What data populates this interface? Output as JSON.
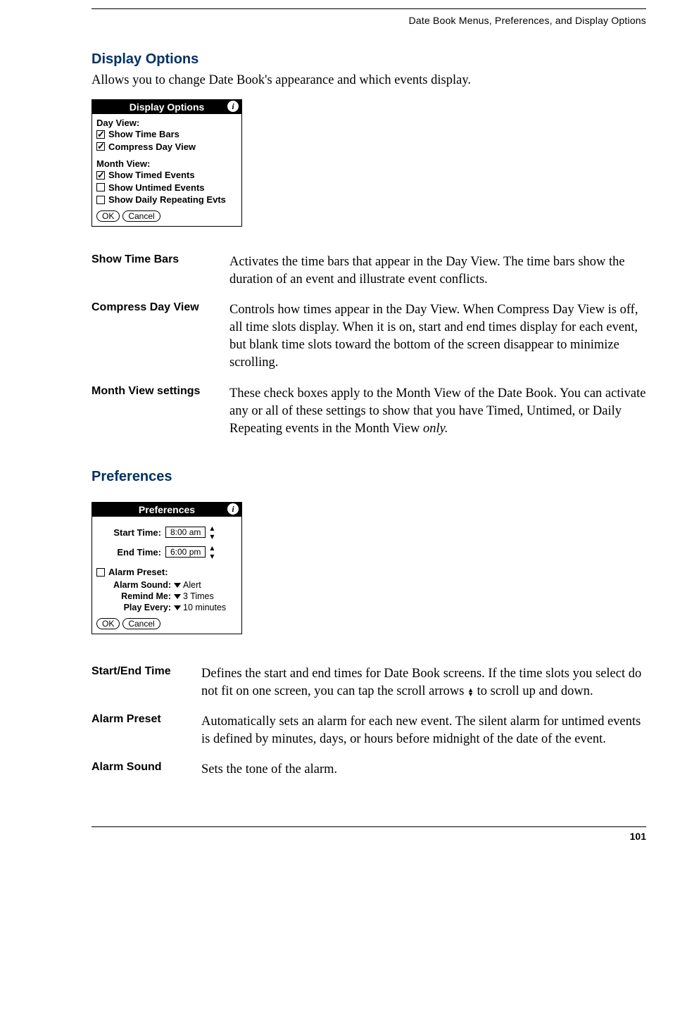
{
  "header": {
    "running_head": "Date Book Menus, Preferences, and Display Options"
  },
  "section1": {
    "title": "Display Options",
    "intro": "Allows you to change Date Book's appearance and which events display."
  },
  "figure1": {
    "title": "Display Options",
    "section_a": "Day View:",
    "row_a1": "Show Time Bars",
    "row_a2": "Compress Day View",
    "section_b": "Month View:",
    "row_b1": "Show Timed Events",
    "row_b2": "Show Untimed Events",
    "row_b3": "Show Daily Repeating Evts",
    "btn_ok": "OK",
    "btn_cancel": "Cancel"
  },
  "defs1": [
    {
      "term": "Show Time Bars",
      "desc": "Activates the time bars that appear in the Day View. The time bars show the duration of an event and illustrate event conflicts."
    },
    {
      "term": "Compress Day View",
      "desc": "Controls how times appear in the Day View. When Compress Day View is off, all time slots display. When it is on, start and end times display for each event, but blank time slots toward the bottom of the screen disappear to minimize scrolling."
    },
    {
      "term": "Month View settings",
      "desc_prefix": "These check boxes apply to the Month View of the Date Book. You can activate any or all of these settings to show that you have Timed, Untimed, or Daily Repeating events in the Month View ",
      "desc_italic": "only."
    }
  ],
  "section2": {
    "title": "Preferences"
  },
  "figure2": {
    "title": "Preferences",
    "start_label": "Start Time:",
    "start_value": "8:00 am",
    "end_label": "End Time:",
    "end_value": "6:00 pm",
    "alarm_preset_label": "Alarm Preset:",
    "alarm_sound_label": "Alarm Sound:",
    "alarm_sound_value": "Alert",
    "remind_label": "Remind Me:",
    "remind_value": "3 Times",
    "play_label": "Play Every:",
    "play_value": "10 minutes",
    "btn_ok": "OK",
    "btn_cancel": "Cancel"
  },
  "defs2": [
    {
      "term": "Start/End Time",
      "desc_prefix": "Defines the start and end times for Date Book screens. If the time slots you select do not fit on one screen, you can tap the scroll arrows ",
      "desc_suffix": " to scroll up and down."
    },
    {
      "term": "Alarm Preset",
      "desc": "Automatically sets an alarm for each new event. The silent alarm for untimed events is defined by minutes, days, or hours before midnight of the date of the event."
    },
    {
      "term": "Alarm Sound",
      "desc": "Sets the tone of the alarm."
    }
  ],
  "footer": {
    "page_number": "101"
  }
}
